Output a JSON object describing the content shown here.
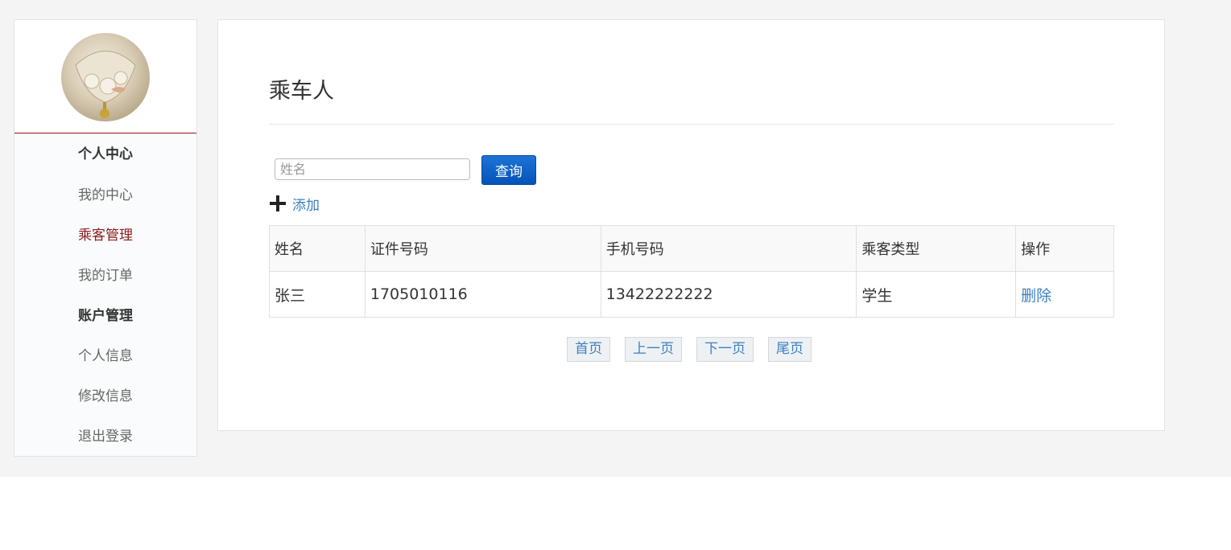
{
  "sidebar": {
    "items": [
      {
        "label": "个人中心",
        "type": "head"
      },
      {
        "label": "我的中心",
        "type": "item"
      },
      {
        "label": "乘客管理",
        "type": "active"
      },
      {
        "label": "我的订单",
        "type": "item"
      },
      {
        "label": "账户管理",
        "type": "head"
      },
      {
        "label": "个人信息",
        "type": "item"
      },
      {
        "label": "修改信息",
        "type": "item"
      },
      {
        "label": "退出登录",
        "type": "item"
      }
    ]
  },
  "main": {
    "title": "乘车人",
    "search": {
      "placeholder": "姓名",
      "value": "",
      "button_label": "查询"
    },
    "add_label": "添加",
    "table": {
      "headers": [
        "姓名",
        "证件号码",
        "手机号码",
        "乘客类型",
        "操作"
      ],
      "rows": [
        {
          "name": "张三",
          "id_number": "1705010116",
          "phone": "13422222222",
          "type": "学生",
          "action": "删除"
        }
      ]
    },
    "pager": {
      "first": "首页",
      "prev": "上一页",
      "next": "下一页",
      "last": "尾页"
    }
  },
  "colors": {
    "accent": "#8b1a1a",
    "link": "#3c7fc0",
    "button": "#0a5fc4"
  }
}
